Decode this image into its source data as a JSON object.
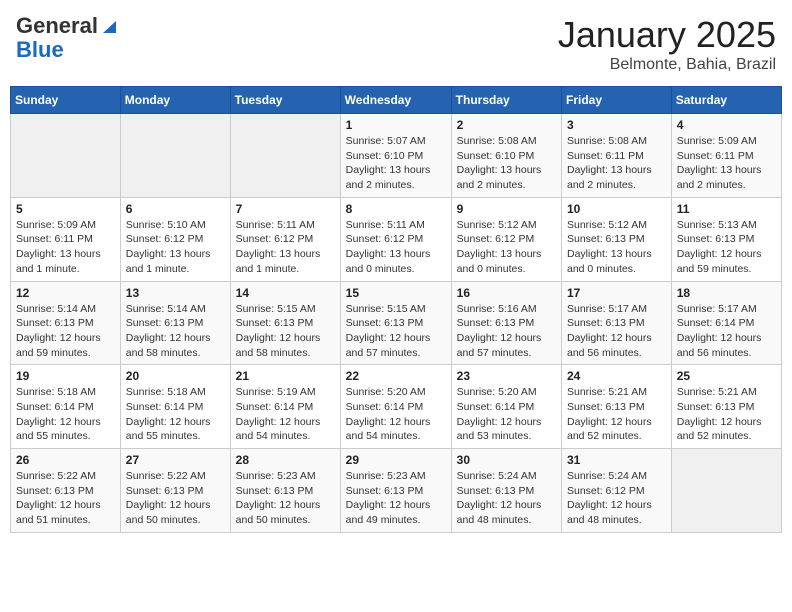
{
  "header": {
    "logo_general": "General",
    "logo_blue": "Blue",
    "month_title": "January 2025",
    "subtitle": "Belmonte, Bahia, Brazil"
  },
  "days_of_week": [
    "Sunday",
    "Monday",
    "Tuesday",
    "Wednesday",
    "Thursday",
    "Friday",
    "Saturday"
  ],
  "weeks": [
    [
      {
        "day": "",
        "info": ""
      },
      {
        "day": "",
        "info": ""
      },
      {
        "day": "",
        "info": ""
      },
      {
        "day": "1",
        "info": "Sunrise: 5:07 AM\nSunset: 6:10 PM\nDaylight: 13 hours\nand 2 minutes."
      },
      {
        "day": "2",
        "info": "Sunrise: 5:08 AM\nSunset: 6:10 PM\nDaylight: 13 hours\nand 2 minutes."
      },
      {
        "day": "3",
        "info": "Sunrise: 5:08 AM\nSunset: 6:11 PM\nDaylight: 13 hours\nand 2 minutes."
      },
      {
        "day": "4",
        "info": "Sunrise: 5:09 AM\nSunset: 6:11 PM\nDaylight: 13 hours\nand 2 minutes."
      }
    ],
    [
      {
        "day": "5",
        "info": "Sunrise: 5:09 AM\nSunset: 6:11 PM\nDaylight: 13 hours\nand 1 minute."
      },
      {
        "day": "6",
        "info": "Sunrise: 5:10 AM\nSunset: 6:12 PM\nDaylight: 13 hours\nand 1 minute."
      },
      {
        "day": "7",
        "info": "Sunrise: 5:11 AM\nSunset: 6:12 PM\nDaylight: 13 hours\nand 1 minute."
      },
      {
        "day": "8",
        "info": "Sunrise: 5:11 AM\nSunset: 6:12 PM\nDaylight: 13 hours\nand 0 minutes."
      },
      {
        "day": "9",
        "info": "Sunrise: 5:12 AM\nSunset: 6:12 PM\nDaylight: 13 hours\nand 0 minutes."
      },
      {
        "day": "10",
        "info": "Sunrise: 5:12 AM\nSunset: 6:13 PM\nDaylight: 13 hours\nand 0 minutes."
      },
      {
        "day": "11",
        "info": "Sunrise: 5:13 AM\nSunset: 6:13 PM\nDaylight: 12 hours\nand 59 minutes."
      }
    ],
    [
      {
        "day": "12",
        "info": "Sunrise: 5:14 AM\nSunset: 6:13 PM\nDaylight: 12 hours\nand 59 minutes."
      },
      {
        "day": "13",
        "info": "Sunrise: 5:14 AM\nSunset: 6:13 PM\nDaylight: 12 hours\nand 58 minutes."
      },
      {
        "day": "14",
        "info": "Sunrise: 5:15 AM\nSunset: 6:13 PM\nDaylight: 12 hours\nand 58 minutes."
      },
      {
        "day": "15",
        "info": "Sunrise: 5:15 AM\nSunset: 6:13 PM\nDaylight: 12 hours\nand 57 minutes."
      },
      {
        "day": "16",
        "info": "Sunrise: 5:16 AM\nSunset: 6:13 PM\nDaylight: 12 hours\nand 57 minutes."
      },
      {
        "day": "17",
        "info": "Sunrise: 5:17 AM\nSunset: 6:13 PM\nDaylight: 12 hours\nand 56 minutes."
      },
      {
        "day": "18",
        "info": "Sunrise: 5:17 AM\nSunset: 6:14 PM\nDaylight: 12 hours\nand 56 minutes."
      }
    ],
    [
      {
        "day": "19",
        "info": "Sunrise: 5:18 AM\nSunset: 6:14 PM\nDaylight: 12 hours\nand 55 minutes."
      },
      {
        "day": "20",
        "info": "Sunrise: 5:18 AM\nSunset: 6:14 PM\nDaylight: 12 hours\nand 55 minutes."
      },
      {
        "day": "21",
        "info": "Sunrise: 5:19 AM\nSunset: 6:14 PM\nDaylight: 12 hours\nand 54 minutes."
      },
      {
        "day": "22",
        "info": "Sunrise: 5:20 AM\nSunset: 6:14 PM\nDaylight: 12 hours\nand 54 minutes."
      },
      {
        "day": "23",
        "info": "Sunrise: 5:20 AM\nSunset: 6:14 PM\nDaylight: 12 hours\nand 53 minutes."
      },
      {
        "day": "24",
        "info": "Sunrise: 5:21 AM\nSunset: 6:13 PM\nDaylight: 12 hours\nand 52 minutes."
      },
      {
        "day": "25",
        "info": "Sunrise: 5:21 AM\nSunset: 6:13 PM\nDaylight: 12 hours\nand 52 minutes."
      }
    ],
    [
      {
        "day": "26",
        "info": "Sunrise: 5:22 AM\nSunset: 6:13 PM\nDaylight: 12 hours\nand 51 minutes."
      },
      {
        "day": "27",
        "info": "Sunrise: 5:22 AM\nSunset: 6:13 PM\nDaylight: 12 hours\nand 50 minutes."
      },
      {
        "day": "28",
        "info": "Sunrise: 5:23 AM\nSunset: 6:13 PM\nDaylight: 12 hours\nand 50 minutes."
      },
      {
        "day": "29",
        "info": "Sunrise: 5:23 AM\nSunset: 6:13 PM\nDaylight: 12 hours\nand 49 minutes."
      },
      {
        "day": "30",
        "info": "Sunrise: 5:24 AM\nSunset: 6:13 PM\nDaylight: 12 hours\nand 48 minutes."
      },
      {
        "day": "31",
        "info": "Sunrise: 5:24 AM\nSunset: 6:12 PM\nDaylight: 12 hours\nand 48 minutes."
      },
      {
        "day": "",
        "info": ""
      }
    ]
  ]
}
